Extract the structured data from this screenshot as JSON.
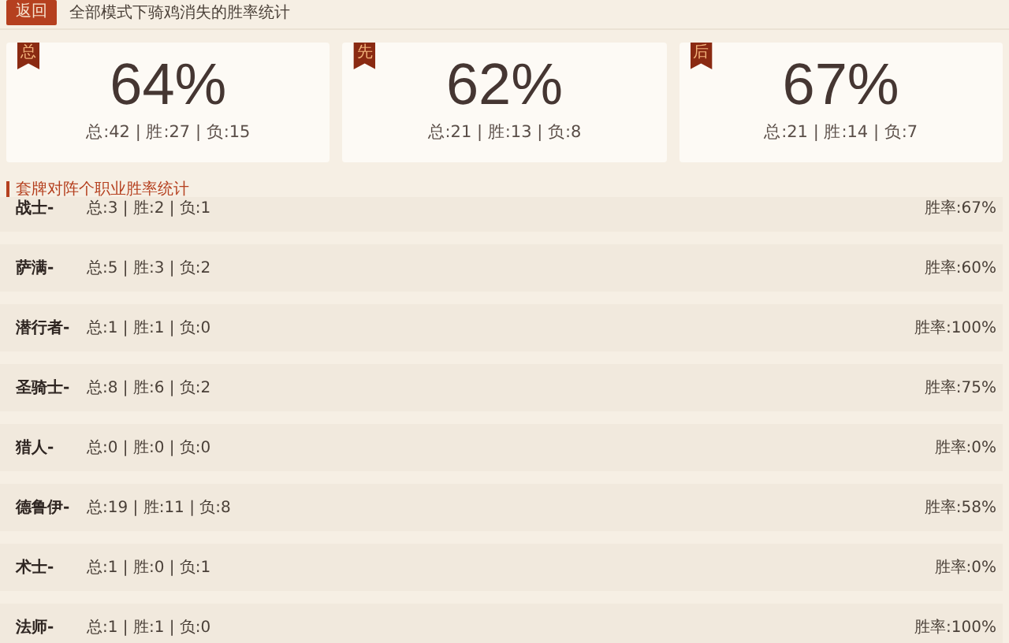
{
  "header": {
    "back_button": "返回",
    "title": "全部模式下骑鸡消失的胜率统计"
  },
  "cards": [
    {
      "badge": "总",
      "rate": "64%",
      "stats": "总:42 | 胜:27 | 负:15"
    },
    {
      "badge": "先",
      "rate": "62%",
      "stats": "总:21 | 胜:13 | 负:8"
    },
    {
      "badge": "后",
      "rate": "67%",
      "stats": "总:21 | 胜:14 | 负:7"
    }
  ],
  "section_title": "套牌对阵个职业胜率统计",
  "rows": [
    {
      "name": "战士-",
      "stats": "总:3 | 胜:2 | 负:1",
      "rate": "胜率:67%"
    },
    {
      "name": "萨满-",
      "stats": "总:5 | 胜:3 | 负:2",
      "rate": "胜率:60%"
    },
    {
      "name": "潜行者-",
      "stats": "总:1 | 胜:1 | 负:0",
      "rate": "胜率:100%"
    },
    {
      "name": "圣骑士-",
      "stats": "总:8 | 胜:6 | 负:2",
      "rate": "胜率:75%"
    },
    {
      "name": "猎人-",
      "stats": "总:0 | 胜:0 | 负:0",
      "rate": "胜率:0%"
    },
    {
      "name": "德鲁伊-",
      "stats": "总:19 | 胜:11 | 负:8",
      "rate": "胜率:58%"
    },
    {
      "name": "术士-",
      "stats": "总:1 | 胜:0 | 负:1",
      "rate": "胜率:0%"
    },
    {
      "name": "法师-",
      "stats": "总:1 | 胜:1 | 负:0",
      "rate": "胜率:100%"
    }
  ]
}
